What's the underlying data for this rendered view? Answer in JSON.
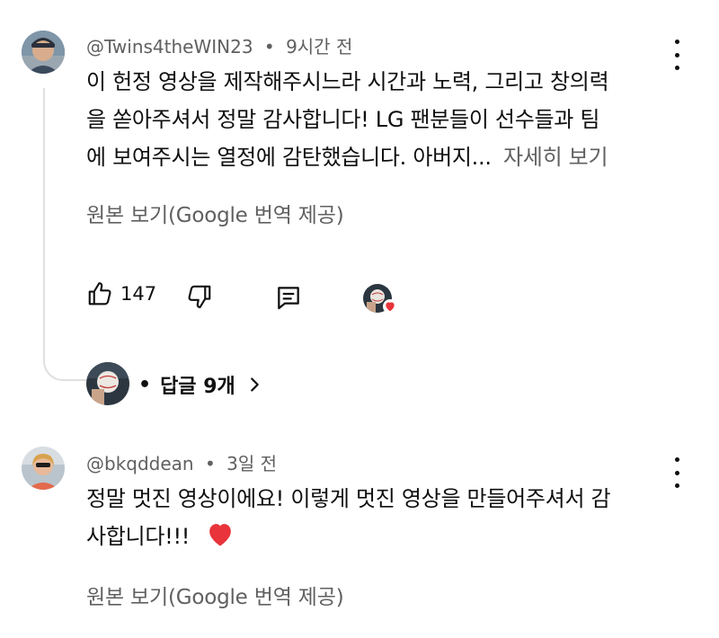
{
  "comments": [
    {
      "author": "@Twins4theWIN23",
      "time": "9시간 전",
      "text_lines": [
        "이 헌정 영상을 제작해주시느라 시간과 노력, 그리고 창의력",
        "을 쏟아주셔서 정말 감사합니다! LG 팬분들이 선수들과 팀",
        "에 보여주시는 열정에 감탄했습니다. 아버지..."
      ],
      "more_label": "자세히 보기",
      "translate_label": "원본 보기(Google 번역 제공)",
      "like_count": "147",
      "replies_label": "답글 9개"
    },
    {
      "author": "@bkqddean",
      "time": "3일 전",
      "text_lines": [
        "정말 멋진 영상이에요! 이렇게 멋진 영상을 만들어주셔서 감",
        "사합니다!!!"
      ],
      "emoji": "❤️",
      "translate_label": "원본 보기(Google 번역 제공)"
    }
  ],
  "separator": "•",
  "icons": [
    "thumbs-up-icon",
    "thumbs-down-icon",
    "reply-icon",
    "creator-heart-icon",
    "chevron-right-icon",
    "more-vert-icon"
  ],
  "colors": {
    "text": "#0f0f0f",
    "secondary": "#606060",
    "heart": "#e8343a",
    "thread_line": "#e0e0e0"
  }
}
